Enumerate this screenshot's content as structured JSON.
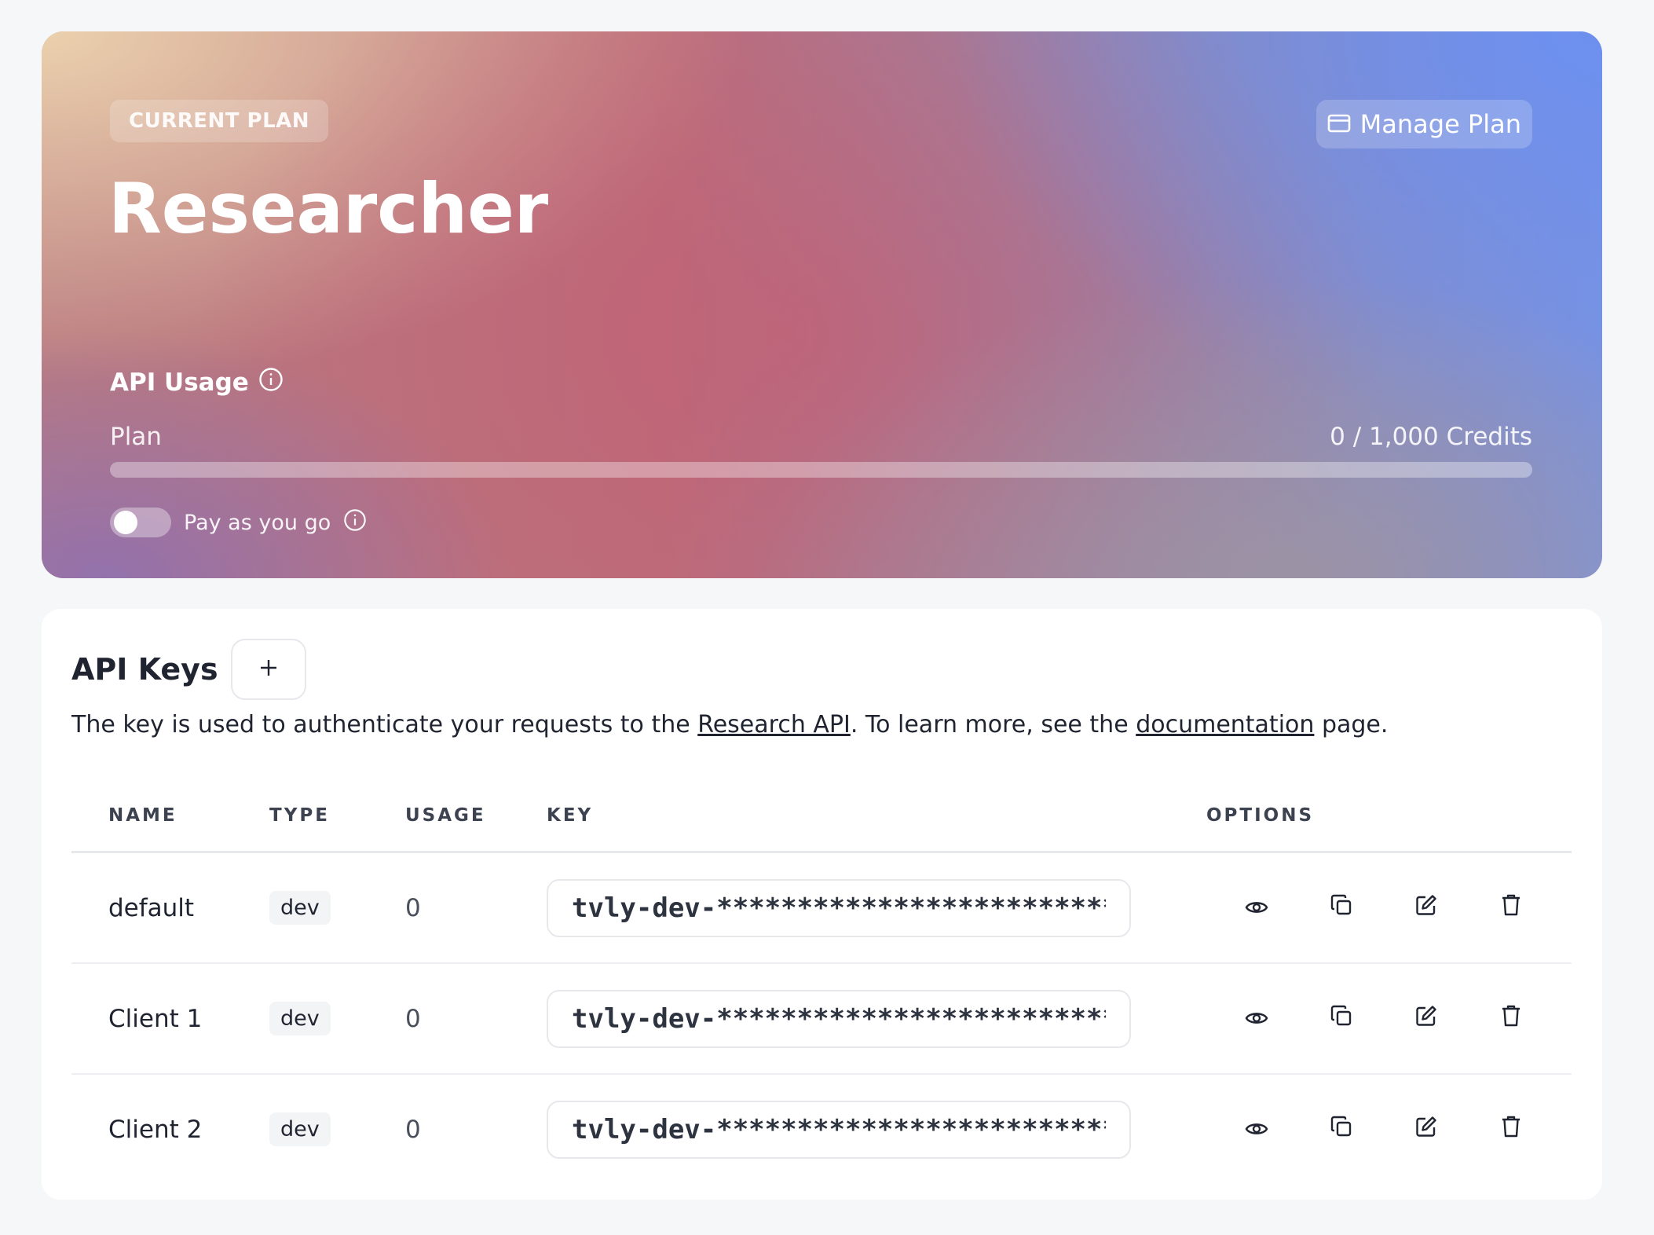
{
  "plan": {
    "badge": "CURRENT PLAN",
    "name": "Researcher",
    "manage_label": "Manage Plan",
    "usage_title": "API Usage",
    "plan_label": "Plan",
    "credits_text": "0 / 1,000 Credits",
    "progress_fraction": 0,
    "payg_label": "Pay as you go",
    "payg_enabled": false
  },
  "api_keys": {
    "title": "API Keys",
    "add_label": "+",
    "desc_prefix": "The key is used to authenticate your requests to the ",
    "desc_link1": "Research API",
    "desc_middle": ". To learn more, see the ",
    "desc_link2": "documentation",
    "desc_suffix": " page.",
    "columns": [
      "NAME",
      "TYPE",
      "USAGE",
      "KEY",
      "OPTIONS"
    ],
    "rows": [
      {
        "name": "default",
        "type": "dev",
        "usage": "0",
        "key": "tvly-dev-**********************************"
      },
      {
        "name": "Client 1",
        "type": "dev",
        "usage": "0",
        "key": "tvly-dev-**********************************"
      },
      {
        "name": "Client 2",
        "type": "dev",
        "usage": "0",
        "key": "tvly-dev-**********************************"
      }
    ],
    "option_icons": [
      "eye-icon",
      "copy-icon",
      "edit-icon",
      "trash-icon"
    ]
  }
}
